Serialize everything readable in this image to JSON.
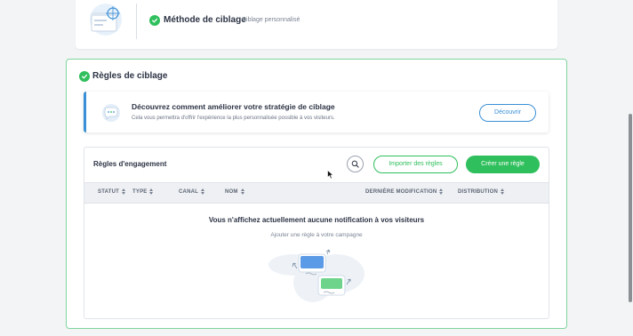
{
  "top_section": {
    "title": "Méthode de ciblage",
    "subtitle": "Ciblage personnalisé"
  },
  "targeting": {
    "title": "Règles de ciblage",
    "banner": {
      "title": "Découvrez comment améliorer votre stratégie de ciblage",
      "subtitle": "Cela vous permettra d'offrir l'expérience la plus personnalisée possible à vos visiteurs.",
      "button_label": "Découvrir"
    },
    "rules": {
      "title": "Règles d'engagement",
      "import_label": "Importer des règles",
      "create_label": "Créer une règle",
      "columns": [
        "STATUT",
        "TYPE",
        "CANAL",
        "NOM",
        "DERNIÈRE MODIFICATION",
        "DISTRIBUTION"
      ],
      "empty_title": "Vous n'affichez actuellement aucune notification à vos visiteurs",
      "empty_subtitle": "Ajouter une règle à votre campagne"
    }
  },
  "colors": {
    "success": "#2fbf5c",
    "accent_blue": "#3b8fd6",
    "panel_border": "#7fd59b"
  },
  "icons": [
    "check-circle-icon",
    "search-icon",
    "sort-icon",
    "cursor-icon"
  ]
}
